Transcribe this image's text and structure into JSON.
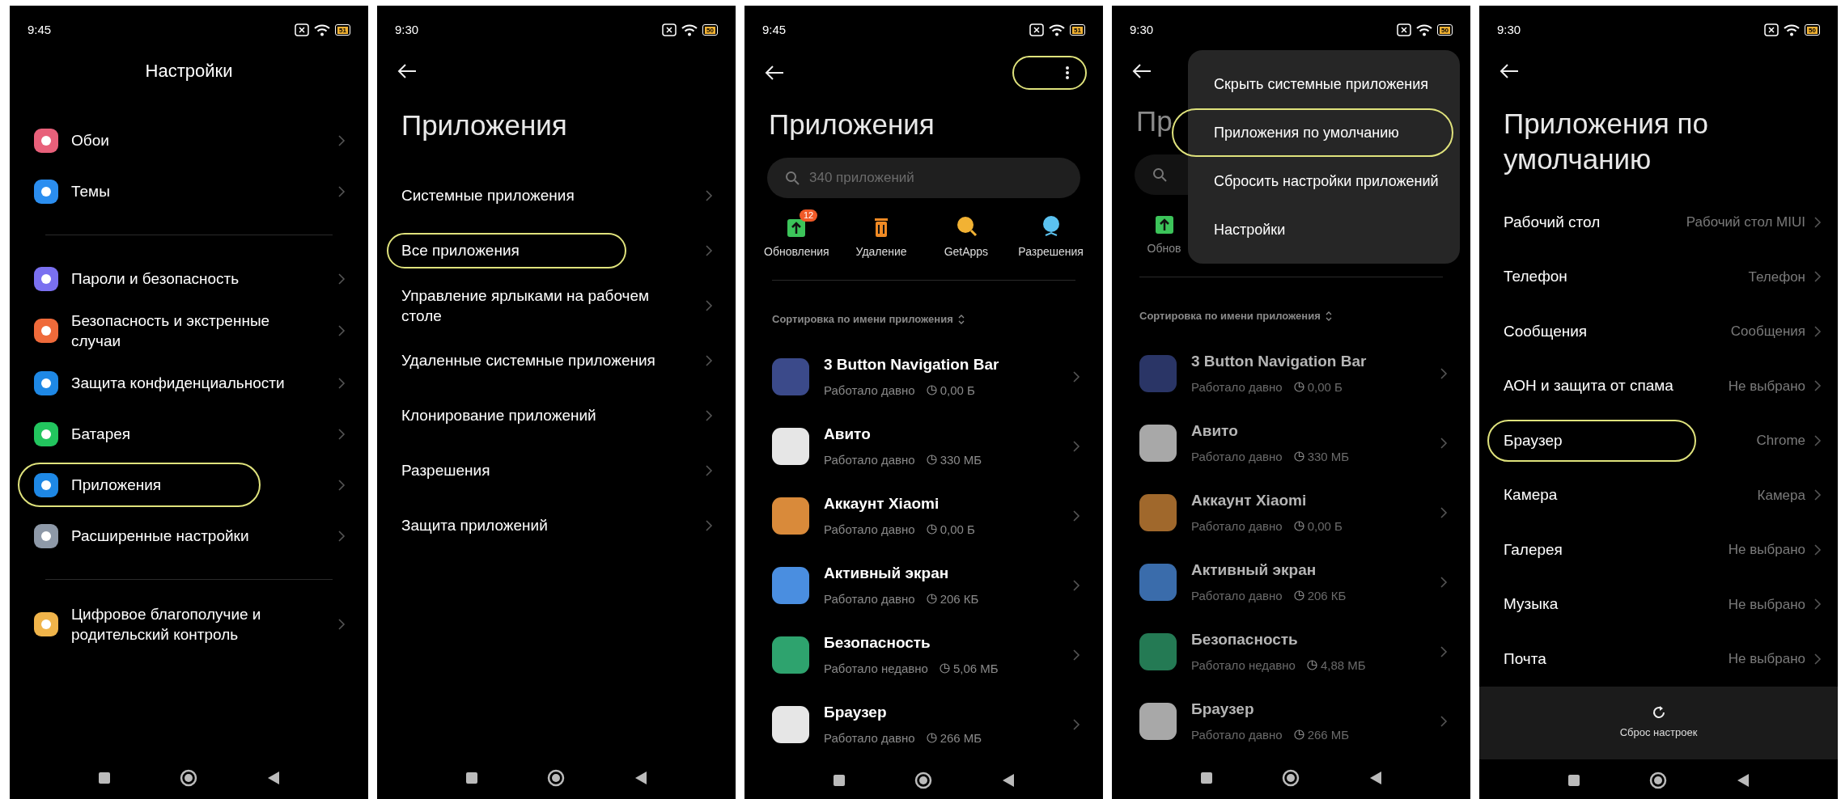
{
  "screens": [
    {
      "kind": "settings",
      "time": "9:45",
      "battery": "51",
      "title": "Настройки",
      "groups": [
        {
          "items": [
            {
              "label": "Обои",
              "color": "#e8607a",
              "highlighted": false
            },
            {
              "label": "Темы",
              "color": "#2b8ef0",
              "highlighted": false
            }
          ]
        },
        {
          "items": [
            {
              "label": "Пароли и безопасность",
              "color": "#7a70f0",
              "highlighted": false
            },
            {
              "label": "Безопасность и экстренные случаи",
              "color": "#ef6a3a",
              "highlighted": false
            },
            {
              "label": "Защита конфиденциальности",
              "color": "#1e88e5",
              "highlighted": false
            },
            {
              "label": "Батарея",
              "color": "#22c55e",
              "highlighted": false
            },
            {
              "label": "Приложения",
              "color": "#1e88e5",
              "highlighted": true
            },
            {
              "label": "Расширенные настройки",
              "color": "#8e99a8",
              "highlighted": false
            }
          ]
        },
        {
          "items": [
            {
              "label": "Цифровое благополучие и родительский контроль",
              "color": "#f0b44a",
              "highlighted": false
            }
          ]
        }
      ]
    },
    {
      "kind": "menu_list",
      "time": "9:30",
      "battery": "50",
      "title": "Приложения",
      "items": [
        {
          "label": "Системные приложения",
          "highlighted": false
        },
        {
          "label": "Все приложения",
          "highlighted": true
        },
        {
          "label": "Управление ярлыками на рабочем столе",
          "highlighted": false
        },
        {
          "label": "Удаленные системные приложения",
          "highlighted": false
        },
        {
          "label": "Клонирование приложений",
          "highlighted": false
        },
        {
          "label": "Разрешения",
          "highlighted": false
        },
        {
          "label": "Защита приложений",
          "highlighted": false
        }
      ]
    },
    {
      "kind": "app_list",
      "time": "9:45",
      "battery": "51",
      "title": "Приложения",
      "more": {
        "highlighted": true
      },
      "search_placeholder": "340 приложений",
      "tools": [
        {
          "label": "Обновления",
          "badge": "12"
        },
        {
          "label": "Удаление"
        },
        {
          "label": "GetApps"
        },
        {
          "label": "Разрешения"
        }
      ],
      "sort": "Сортировка по имени приложения",
      "apps": [
        {
          "name": "3 Button Navigation Bar",
          "status": "Работало давно",
          "size": "0,00 Б",
          "color": "#3b4a8a"
        },
        {
          "name": "Авито",
          "status": "Работало давно",
          "size": "330 МБ",
          "color": "#e6e6e6"
        },
        {
          "name": "Аккаунт Xiaomi",
          "status": "Работало давно",
          "size": "0,00 Б",
          "color": "#d98a3a"
        },
        {
          "name": "Активный экран",
          "status": "Работало давно",
          "size": "206 КБ",
          "color": "#4a8ee0"
        },
        {
          "name": "Безопасность",
          "status": "Работало недавно",
          "size": "5,06 МБ",
          "color": "#2ea36e"
        },
        {
          "name": "Браузер",
          "status": "Работало давно",
          "size": "266 МБ",
          "color": "#e6e6e6"
        }
      ]
    },
    {
      "kind": "app_list",
      "time": "9:30",
      "battery": "50",
      "title": "Пр",
      "tools": [
        {
          "label": "Обнов"
        }
      ],
      "sort": "Сортировка по имени приложения",
      "apps": [
        {
          "name": "3 Button Navigation Bar",
          "status": "Работало давно",
          "size": "0,00 Б",
          "color": "#2a3566"
        },
        {
          "name": "Авито",
          "status": "Работало давно",
          "size": "330 МБ",
          "color": "#a8a8a8"
        },
        {
          "name": "Аккаунт Xiaomi",
          "status": "Работало давно",
          "size": "0,00 Б",
          "color": "#a0682c"
        },
        {
          "name": "Активный экран",
          "status": "Работало давно",
          "size": "206 КБ",
          "color": "#3a6cab"
        },
        {
          "name": "Безопасность",
          "status": "Работало недавно",
          "size": "4,88 МБ",
          "color": "#247a54"
        },
        {
          "name": "Браузер",
          "status": "Работало давно",
          "size": "266 МБ",
          "color": "#a8a8a8"
        }
      ],
      "menu": {
        "items": [
          {
            "label": "Скрыть системные приложения",
            "highlighted": false
          },
          {
            "label": "Приложения по умолчанию",
            "highlighted": true
          },
          {
            "label": "Сбросить настройки приложений",
            "highlighted": false
          },
          {
            "label": "Настройки",
            "highlighted": false
          }
        ]
      }
    },
    {
      "kind": "defaults",
      "time": "9:30",
      "battery": "50",
      "title": "Приложения по умолчанию",
      "rows": [
        {
          "label": "Рабочий стол",
          "value": "Рабочий стол MIUI",
          "highlighted": false
        },
        {
          "label": "Телефон",
          "value": "Телефон",
          "highlighted": false
        },
        {
          "label": "Сообщения",
          "value": "Сообщения",
          "highlighted": false
        },
        {
          "label": "АОН и защита от спама",
          "value": "Не выбрано",
          "highlighted": false
        },
        {
          "label": "Браузер",
          "value": "Chrome",
          "highlighted": true
        },
        {
          "label": "Камера",
          "value": "Камера",
          "highlighted": false
        },
        {
          "label": "Галерея",
          "value": "Не выбрано",
          "highlighted": false
        },
        {
          "label": "Музыка",
          "value": "Не выбрано",
          "highlighted": false
        },
        {
          "label": "Почта",
          "value": "Не выбрано",
          "highlighted": false
        }
      ],
      "reset": "Сброс настроек"
    }
  ]
}
